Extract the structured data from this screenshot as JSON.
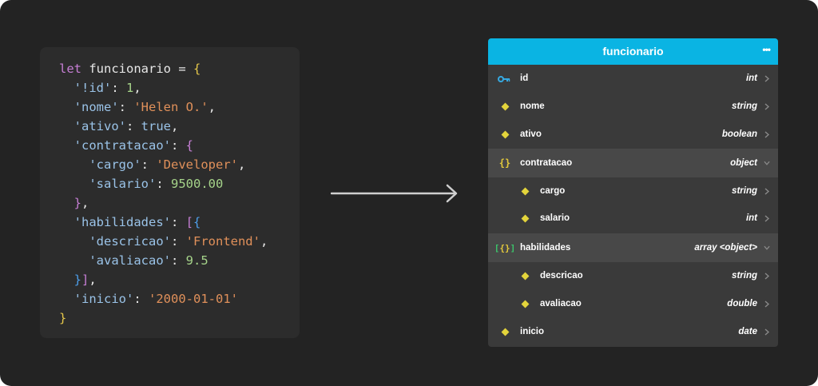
{
  "code": {
    "let_kw": "let",
    "var_name": "funcionario",
    "equals": "=",
    "key_id": "'!id'",
    "val_id": "1",
    "key_nome": "'nome'",
    "val_nome": "'Helen O.'",
    "key_ativo": "'ativo'",
    "val_ativo": "true",
    "key_contratacao": "'contratacao'",
    "key_cargo": "'cargo'",
    "val_cargo": "'Developer'",
    "key_salario": "'salario'",
    "val_salario": "9500.00",
    "key_habilidades": "'habilidades'",
    "key_descricao": "'descricao'",
    "val_descricao": "'Frontend'",
    "key_avaliacao": "'avaliacao'",
    "val_avaliacao": "9.5",
    "key_inicio": "'inicio'",
    "val_inicio": "'2000-01-01'"
  },
  "table": {
    "title": "funcionario",
    "more": "•••",
    "rows": [
      {
        "name": "id",
        "type": "int",
        "icon": "key-icon"
      },
      {
        "name": "nome",
        "type": "string",
        "icon": "diamond-icon"
      },
      {
        "name": "ativo",
        "type": "boolean",
        "icon": "diamond-icon"
      },
      {
        "name": "contratacao",
        "type": "object",
        "icon": "object-braces-icon"
      },
      {
        "name": "cargo",
        "type": "string",
        "icon": "diamond-icon"
      },
      {
        "name": "salario",
        "type": "int",
        "icon": "diamond-icon"
      },
      {
        "name": "habilidades",
        "type": "array <object>",
        "icon": "array-object-icon"
      },
      {
        "name": "descricao",
        "type": "string",
        "icon": "diamond-icon"
      },
      {
        "name": "avaliacao",
        "type": "double",
        "icon": "diamond-icon"
      },
      {
        "name": "inicio",
        "type": "date",
        "icon": "diamond-icon"
      }
    ]
  },
  "colors": {
    "header": "#0ab4e3",
    "key_icon": "#36a9e1",
    "diamond": "#e3d43b"
  }
}
